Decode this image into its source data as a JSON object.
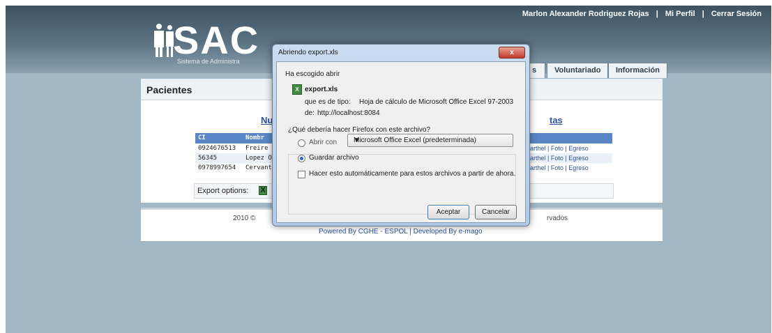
{
  "user_nav": {
    "user_name": "Marlon Alexander Rodriguez Rojas",
    "separator": "|",
    "profile": "Mi Perfil",
    "logout": "Cerrar Sesión"
  },
  "logo": {
    "text": "SAC",
    "subtitle": "Sistema de Administra"
  },
  "tabs": [
    "s",
    "Voluntariado",
    "Información"
  ],
  "page": {
    "title": "Pacientes",
    "link_left": "Nu",
    "link_right": "tas"
  },
  "table": {
    "headers": [
      "CI",
      "Nombr"
    ],
    "rows": [
      {
        "ci": "0924676513",
        "name": "Freire L",
        "actions": "arthel | Foto | Egreso"
      },
      {
        "ci": "56345",
        "name": "Lopez O",
        "actions": "arthel | Foto | Egreso"
      },
      {
        "ci": "0978997654",
        "name": "Cervant",
        "actions": "arthel | Foto | Egreso"
      }
    ]
  },
  "export": {
    "label": "Export options:",
    "icon": "excel-icon"
  },
  "footer": {
    "copyright": "2010 ©",
    "rights": "rvados",
    "powered": "Powered By CGHE - ESPOL | Developed By e-mago"
  },
  "dialog": {
    "title": "Abriendo export.xls",
    "close_label": "x",
    "intro": "Ha escogido abrir",
    "filename": "export.xls",
    "type_label": "que es de tipo:",
    "type_value": "Hoja de cálculo de Microsoft Office Excel 97-2003",
    "from_label": "de:",
    "from_value": "http://localhost:8084",
    "question": "¿Qué debería hacer Firefox con este archivo?",
    "open_with_label": "Abrir con",
    "open_with_value": "Microsoft Office Excel (predeterminada)",
    "save_label": "Guardar archivo",
    "auto_label": "Hacer esto automáticamente para estos archivos a partir de ahora.",
    "accept": "Aceptar",
    "cancel": "Cancelar",
    "selected_option": "save"
  },
  "colors": {
    "header_dark": "#3d5261",
    "background": "#a3b8c5",
    "link": "#2d52a3",
    "grid_header": "#5a86c7"
  }
}
